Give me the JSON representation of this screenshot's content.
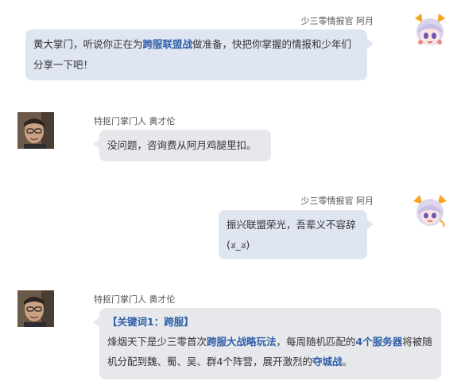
{
  "messages": [
    {
      "sender": "少三零情报官 阿月",
      "parts": [
        "黄大掌门，听说你正在为",
        "跨服联盟战",
        "做准备，快把你掌握的情报和少年们分享一下吧！"
      ]
    },
    {
      "sender": "特抠门掌门人 黄才伦",
      "text": "没问题，咨询费从阿月鸡腿里扣。"
    },
    {
      "sender": "少三零情报官 阿月",
      "line1": "振兴联盟荣光，吾辈义不容辞",
      "line2": "(ತ_ತ)"
    },
    {
      "sender": "特抠门掌门人 黄才伦",
      "keyword": "【关键词1：跨服】",
      "parts": [
        "烽烟天下是少三零首次",
        "跨服大战略玩法",
        "，每周随机匹配的",
        "4个服务器",
        "将被随机分配到魏、蜀、吴、群4个阵营，展开激烈的",
        "夺城战",
        "。"
      ]
    }
  ],
  "colors": {
    "highlight": "#2f5fa8",
    "bubble_right": "#dfe6f1",
    "bubble_left": "#e6e8ec"
  },
  "avatars": {
    "ayue": "anime-girl-avatar",
    "huang": "man-with-glasses-avatar"
  }
}
